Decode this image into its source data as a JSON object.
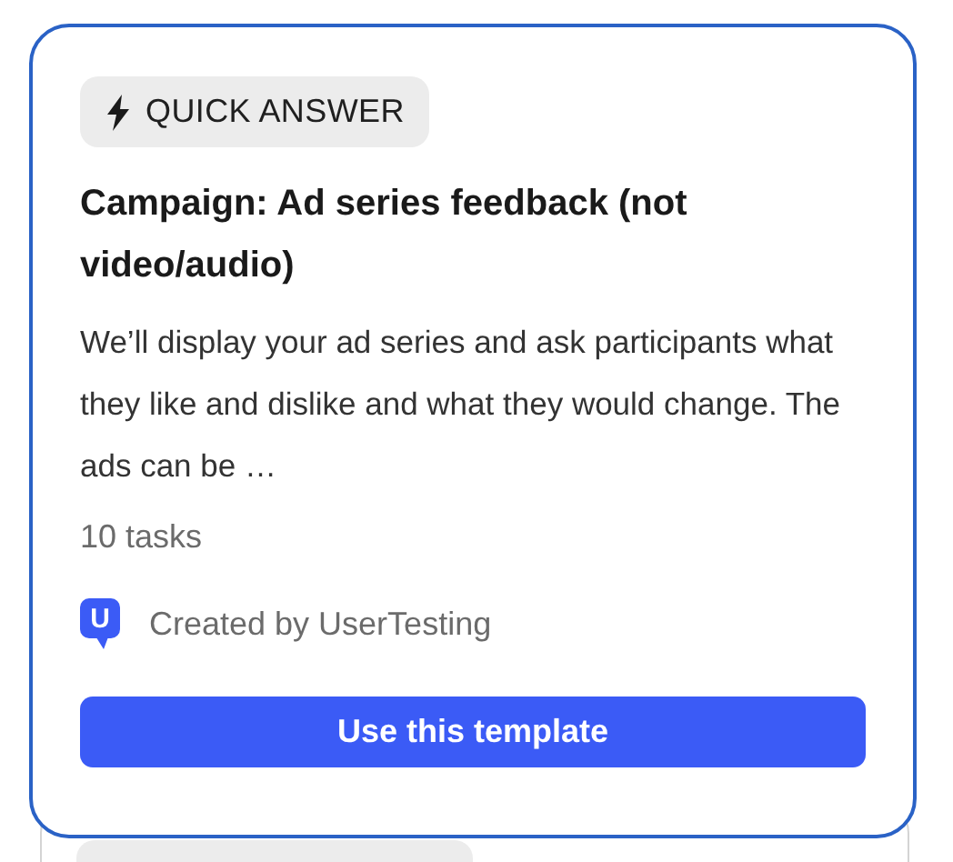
{
  "badge": {
    "label": "QUICK ANSWER"
  },
  "title": "Campaign: Ad series feedback (not video/audio)",
  "description": "We’ll display your ad series and ask participants what they like and dislike and what they would change. The ads can be …",
  "task_count": "10 tasks",
  "creator": {
    "logo_letter": "U",
    "label": "Created by UserTesting"
  },
  "button": "Use this template"
}
